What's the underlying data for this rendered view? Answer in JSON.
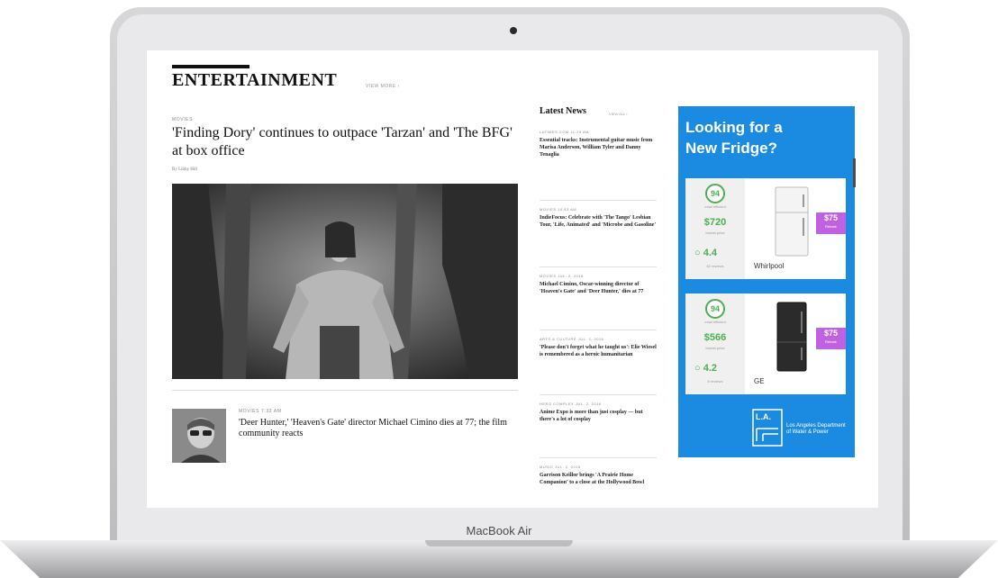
{
  "device": {
    "brand_label": "MacBook Air"
  },
  "section": {
    "title": "ENTERTAINMENT",
    "view_more": "VIEW MORE ›"
  },
  "lead_story": {
    "kicker": "MOVIES",
    "headline": "'Finding Dory' continues to outpace 'Tarzan' and 'The BFG' at box office",
    "byline": "By Libby Hill"
  },
  "second_story": {
    "kicker": "MOVIES  7:32 AM",
    "headline": "'Deer Hunter,' 'Heaven's Gate' director Michael Cimino dies at 77; the film community reacts"
  },
  "latest_news": {
    "title": "Latest News",
    "view_all": "VIEW ALL ›",
    "items": [
      {
        "kicker": "LATIMES.COM  11:25 AM",
        "title": "Essential tracks: Instrumental guitar music from Marisa Anderson, William Tyler and Danny Tenaglia"
      },
      {
        "kicker": "MOVIES  10:43 AM",
        "title": "IndieFocus: Celebrate with 'The Tango' Lesbian Tour, 'Life, Animated' and 'Microbe and Gasoline'"
      },
      {
        "kicker": "MOVIES  JUL. 2, 2016",
        "title": "Michael Cimino, Oscar-winning director of 'Heaven's Gate' and 'Deer Hunter,' dies at 77"
      },
      {
        "kicker": "ARTS & CULTURE  JUL. 2, 2016",
        "title": "'Please don't forget what he taught us': Elie Wiesel is remembered as a heroic humanitarian"
      },
      {
        "kicker": "HERO COMPLEX  JUL. 2, 2016",
        "title": "Anime Expo is more than just cosplay — but there's a lot of cosplay"
      },
      {
        "kicker": "MUSIC  JUL. 2, 2016",
        "title": "Garrison Keillor brings 'A Prairie Home Companion' to a close at the Hollywood Bowl"
      }
    ]
  },
  "ad": {
    "title_line1": "Looking for a",
    "title_line2": "New Fridge?",
    "cards": [
      {
        "score": "94",
        "score_label": "most efficient",
        "price": "$720",
        "price_label": "lowest price",
        "rating": "4.4",
        "reviews_label": "82 reviews",
        "brand": "Whirlpool",
        "rebate_amount": "$75",
        "rebate_label": "Rebate"
      },
      {
        "score": "94",
        "score_label": "most efficient",
        "price": "$566",
        "price_label": "lowest price",
        "rating": "4.2",
        "reviews_label": "8 reviews",
        "brand": "GE",
        "rebate_amount": "$75",
        "rebate_label": "Rebate"
      }
    ],
    "sponsor_logo_text": "L.A.",
    "sponsor_name": "Los Angeles Department of Water & Power"
  },
  "colors": {
    "ad_blue": "#1a8be0",
    "green": "#4caf50",
    "rebate_purple": "#c061e0"
  }
}
